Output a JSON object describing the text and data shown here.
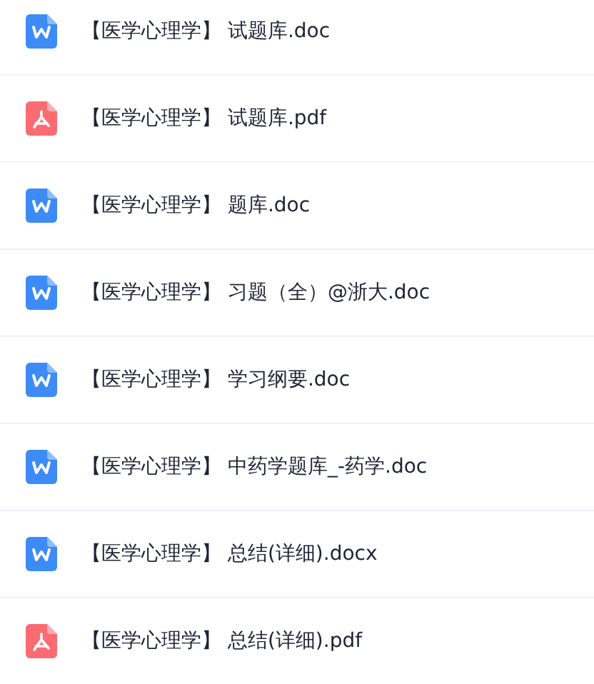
{
  "files": [
    {
      "kind": "word",
      "name": "【医学心理学】 试题库.doc"
    },
    {
      "kind": "pdf",
      "name": "【医学心理学】 试题库.pdf"
    },
    {
      "kind": "word",
      "name": "【医学心理学】 题库.doc"
    },
    {
      "kind": "word",
      "name": "【医学心理学】 习题（全）@浙大.doc"
    },
    {
      "kind": "word",
      "name": "【医学心理学】 学习纲要.doc"
    },
    {
      "kind": "word",
      "name": "【医学心理学】 中药学题库_-药学.doc"
    },
    {
      "kind": "word",
      "name": "【医学心理学】 总结(详细).docx"
    },
    {
      "kind": "pdf",
      "name": "【医学心理学】 总结(详细).pdf"
    }
  ]
}
